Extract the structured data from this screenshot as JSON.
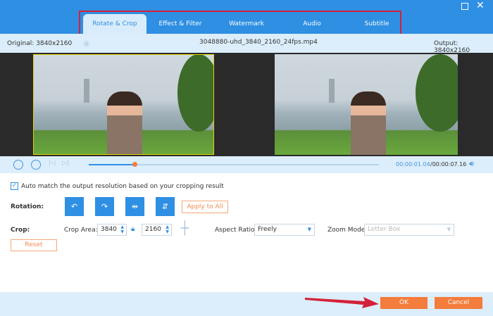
{
  "window": {
    "maximize_icon": "square-icon",
    "close_icon": "x-icon"
  },
  "tabs": [
    {
      "label": "Rotate & Crop",
      "active": true
    },
    {
      "label": "Effect & Filter"
    },
    {
      "label": "Watermark"
    },
    {
      "label": "Audio"
    },
    {
      "label": "Subtitle"
    }
  ],
  "info": {
    "original": "Original: 3840x2160",
    "filename": "3048880-uhd_3840_2160_24fps.mp4",
    "output": "Output: 3840x2160"
  },
  "player": {
    "current_time": "00:00:01.04",
    "total_time": "/00:00:07.16",
    "progress": 0.16
  },
  "options": {
    "auto_match": "Auto match the output resolution based on your cropping result",
    "auto_match_checked": true
  },
  "rotation": {
    "label": "Rotation:",
    "apply_all": "Apply to All"
  },
  "crop": {
    "label": "Crop:",
    "area_label": "Crop Area:",
    "width": "3840",
    "height": "2160",
    "aspect_label": "Aspect Ratio:",
    "aspect_value": "Freely",
    "zoom_label": "Zoom Mode:",
    "zoom_value": "Letter Box",
    "reset": "Reset"
  },
  "footer": {
    "ok": "OK",
    "cancel": "Cancel"
  },
  "colors": {
    "accent": "#2e8fe3",
    "orange": "#f47c3c",
    "highlight": "#d4213a"
  }
}
